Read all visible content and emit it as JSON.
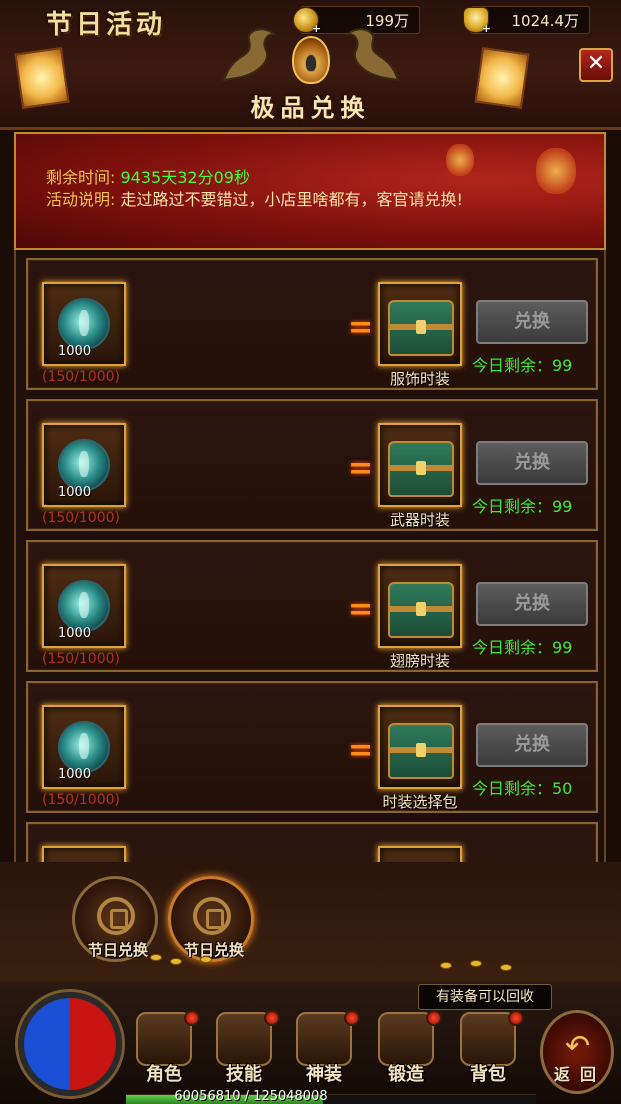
{
  "header": {
    "event_title": "节日活动",
    "page_title": "极品兑换",
    "coin_value": "199万",
    "ingot_value": "1024.4万",
    "coin_icon": "gold-coin-icon",
    "ingot_icon": "gold-ingot-icon",
    "close_icon": "close-icon",
    "close_symbol": "✕"
  },
  "banner": {
    "time_label": "剩余时间:",
    "time_value": "9435天32分09秒",
    "desc_label": "活动说明:",
    "desc_value": "走过路过不要错过，小店里啥都有，客官请兑换!"
  },
  "exchange_list": [
    {
      "input_qty": "1000",
      "progress": "(150/1000)",
      "equals": "=",
      "reward_name": "服饰时装",
      "button": "兑换",
      "remaining": "今日剩余：99"
    },
    {
      "input_qty": "1000",
      "progress": "(150/1000)",
      "equals": "=",
      "reward_name": "武器时装",
      "button": "兑换",
      "remaining": "今日剩余：99"
    },
    {
      "input_qty": "1000",
      "progress": "(150/1000)",
      "equals": "=",
      "reward_name": "翅膀时装",
      "button": "兑换",
      "remaining": "今日剩余：99"
    },
    {
      "input_qty": "1000",
      "progress": "(150/1000)",
      "equals": "=",
      "reward_name": "时装选择包",
      "button": "兑换",
      "remaining": "今日剩余：50"
    }
  ],
  "tabs": [
    {
      "label": "节日兑换",
      "icon": "coin-stack-icon"
    },
    {
      "label": "节日兑换",
      "icon": "coin-stack-icon"
    }
  ],
  "tooltip": "有装备可以回收",
  "nav": {
    "items": [
      {
        "label": "角色",
        "icon": "helmet-icon"
      },
      {
        "label": "技能",
        "icon": "skill-book-icon"
      },
      {
        "label": "神装",
        "icon": "armor-icon"
      },
      {
        "label": "锻造",
        "icon": "forge-icon"
      },
      {
        "label": "背包",
        "icon": "bag-icon"
      }
    ],
    "back_label": "返回",
    "back_icon": "return-arrow-icon",
    "back_symbol": "↶"
  },
  "exp": {
    "text": "60056810 / 125048008",
    "current": 60056810,
    "max": 125048008
  }
}
